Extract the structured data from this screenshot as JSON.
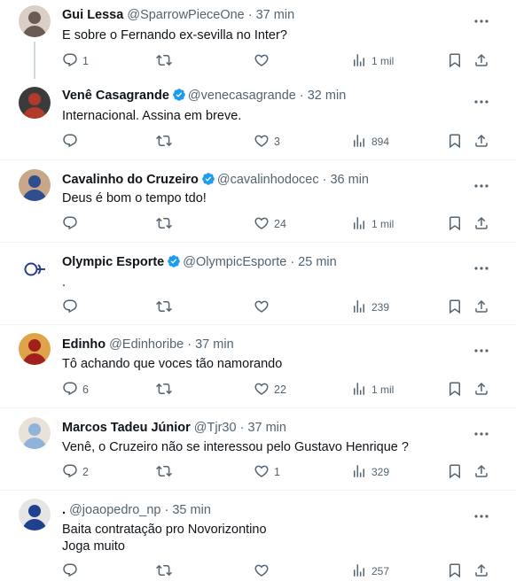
{
  "tweets": [
    {
      "name": "Gui Lessa",
      "handle": "@SparrowPieceOne",
      "time": "· 37 min",
      "verified": false,
      "text": "E sobre o Fernando ex-sevilla no Inter?",
      "text2": "",
      "replies": "1",
      "retweets": "",
      "likes": "",
      "views": "1 mil",
      "avatar_colors": [
        "#6b5b53",
        "#d9cfc7"
      ]
    },
    {
      "name": "Venê Casagrande",
      "handle": "@venecasagrande",
      "time": "· 32 min",
      "verified": true,
      "text": "Internacional. Assina em breve.",
      "text2": "",
      "replies": "",
      "retweets": "",
      "likes": "3",
      "views": "894",
      "avatar_colors": [
        "#b23a2a",
        "#3b3b3b"
      ]
    },
    {
      "name": "Cavalinho do Cruzeiro",
      "handle": "@cavalinhodocec",
      "time": "· 36 min",
      "verified": true,
      "text": "Deus é bom o tempo tdo!",
      "text2": "",
      "replies": "",
      "retweets": "",
      "likes": "24",
      "views": "1 mil",
      "avatar_colors": [
        "#2f4e8f",
        "#c9a88a"
      ]
    },
    {
      "name": "Olympic Esporte",
      "handle": "@OlympicEsporte",
      "time": "· 25 min",
      "verified": true,
      "text": ".",
      "text2": "",
      "replies": "",
      "retweets": "",
      "likes": "",
      "views": "239",
      "avatar_colors": [
        "#ffffff",
        "#2a3d8f"
      ]
    },
    {
      "name": "Edinho",
      "handle": "@Edinhoribe",
      "time": "· 37 min",
      "verified": false,
      "text": "Tô achando que voces tão namorando",
      "text2": "",
      "replies": "6",
      "retweets": "",
      "likes": "22",
      "views": "1 mil",
      "avatar_colors": [
        "#a0201c",
        "#e0a34a"
      ]
    },
    {
      "name": "Marcos Tadeu Júnior",
      "handle": "@Tjr30",
      "time": "· 37 min",
      "verified": false,
      "text": "Venê, o Cruzeiro não se interessou pelo Gustavo Henrique ?",
      "text2": "",
      "replies": "2",
      "retweets": "",
      "likes": "1",
      "views": "329",
      "avatar_colors": [
        "#8fb3d9",
        "#e8e2d8"
      ]
    },
    {
      "name": ".",
      "handle": "@joaopedro_np",
      "time": "· 35 min",
      "verified": false,
      "text": "Baita contratação pro Novorizontino",
      "text2": "Joga muito",
      "replies": "",
      "retweets": "",
      "likes": "",
      "views": "257",
      "avatar_colors": [
        "#1f3f8f",
        "#e5e5e5"
      ]
    }
  ],
  "icons": {
    "reply": "reply-icon",
    "retweet": "retweet-icon",
    "like": "heart-icon",
    "views": "views-icon",
    "bookmark": "bookmark-icon",
    "share": "share-icon",
    "more": "more-icon",
    "verified": "verified-badge-icon"
  },
  "colors": {
    "text": "#0f1419",
    "muted": "#536471",
    "verified": "#1d9bf0",
    "divider": "#eff3f4"
  }
}
